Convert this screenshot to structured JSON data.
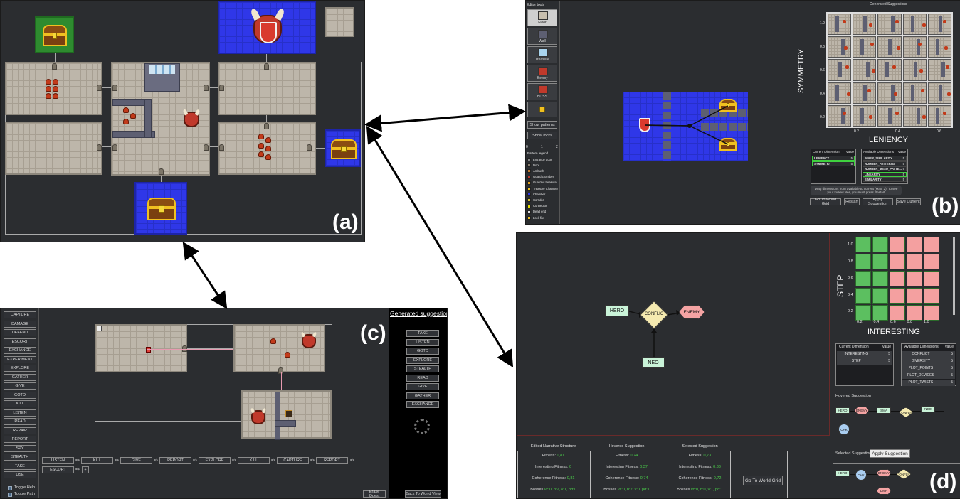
{
  "panels": {
    "a": {
      "tag": "(a)"
    },
    "b": {
      "tag": "(b)",
      "tools_title": "Editor tools",
      "tools": [
        "Floor",
        "Wall",
        "Treasure",
        "Enemy",
        "BOSS"
      ],
      "show_patterns": "Show patterns",
      "show_locks": "Show locks",
      "slider_labels": [
        "0",
        "1",
        "2"
      ],
      "legend_title": "Pattern legend",
      "legend": [
        "Entrance door",
        "Door",
        "Ambush",
        "Guard chamber",
        "Guarded treasure",
        "Treasure Chamber",
        "Chamber",
        "Corridor",
        "Connector",
        "Dead end",
        "Lock file"
      ],
      "generated_title": "Generated Suggestions",
      "y_axis_label": "SYMMETRY",
      "x_axis_label": "LENIENCY",
      "y_ticks": [
        "1.0",
        "0.8",
        "0.6",
        "0.4",
        "0.2"
      ],
      "x_ticks": [
        "0.2",
        "0.4",
        "0.6"
      ],
      "current_dim_header": [
        "Current Dimension",
        "Value"
      ],
      "current_dims": [
        [
          "LENIENCY",
          "5"
        ],
        [
          "SYMMETRY",
          "5"
        ]
      ],
      "available_dim_header": [
        "Available Dimensions",
        "Value"
      ],
      "available_dims": [
        [
          "INNER_SIMILARITY",
          "5"
        ],
        [
          "NUMBER_PATTERNS",
          "5"
        ],
        [
          "NUMBER_MESO_PATTE...",
          "5"
        ],
        [
          "LINEARITY",
          "5"
        ],
        [
          "SIMILARITY",
          "5"
        ]
      ],
      "hint": "Drag dimensions from available to current (Max. 2). To see your locked tiles, you must press Restart",
      "buttons": [
        "Go To World Grid",
        "Restart",
        "Apply Suggestion",
        "Save Current"
      ]
    },
    "c": {
      "tag": "(c)",
      "actions": [
        "CAPTURE",
        "DAMAGE",
        "DEFEND",
        "ESCORT",
        "EXCHANGE",
        "EXPERIMENT",
        "EXPLORE",
        "GATHER",
        "GIVE",
        "GOTO",
        "KILL",
        "LISTEN",
        "READ",
        "REPAIR",
        "REPORT",
        "SPY",
        "STEALTH",
        "TAKE",
        "USE"
      ],
      "toggles": [
        "Toggle Help",
        "Toggle Path"
      ],
      "generated_title": "Generated suggestions",
      "suggestions": [
        "TAKE",
        "LISTEN",
        "GOTO",
        "EXPLORE",
        "STEALTH",
        "READ",
        "GIVE",
        "GATHER",
        "EXCHANGE"
      ],
      "quest_row1": [
        "LISTEN",
        "KILL",
        "GIVE",
        "REPORT",
        "EXPLORE",
        "KILL",
        "CAPTURE",
        "REPORT"
      ],
      "quest_row2": [
        "ESCORT"
      ],
      "plus": "+",
      "arrow_glyph": "=>",
      "erase_quest": "Erase Quest",
      "back_world": "Back To World View"
    },
    "d": {
      "tag": "(d)",
      "nodes": {
        "hero": "HERO",
        "conflict": "CONFLIC",
        "enemy": "ENEMY",
        "neo": "NEO"
      },
      "y_axis_label": "STEP",
      "x_axis_label": "INTERESTING",
      "y_ticks": [
        "1.0",
        "0.8",
        "0.6",
        "0.4",
        "0.2"
      ],
      "x_ticks": [
        "0.2",
        "0.4",
        "0.6",
        "0.8",
        "1.0"
      ],
      "current_dim_header": [
        "Current Dimension",
        "Value"
      ],
      "current_dims": [
        [
          "INTERESTING",
          "5"
        ],
        [
          "STEP",
          "5"
        ]
      ],
      "available_dim_header": [
        "Available Dimensions",
        "Value"
      ],
      "available_dims": [
        [
          "CONFLICT",
          "5"
        ],
        [
          "DIVERSITY",
          "5"
        ],
        [
          "PLOT_POINTS",
          "5"
        ],
        [
          "PLOT_DEVICES",
          "5"
        ],
        [
          "PLOT_TWISTS",
          "5"
        ]
      ],
      "hovered_label": "Hovered Suggestion",
      "selected_label": "Selected Suggestion",
      "apply_button": "Apply Suggestion",
      "hover_nodes": [
        "HERO",
        "ENEMY",
        "SMA",
        "CONFLIC",
        "NEO",
        "CHK"
      ],
      "selected_nodes": [
        "HERO",
        "CHK",
        "ENEMY",
        "CONFLIC",
        "DMP"
      ],
      "columns": [
        {
          "title": "Edited Narrative Structure",
          "fitness": "0,81",
          "interesting": "0",
          "coherence": "0,81",
          "bosses": "vc:0, h:2, v:1, pd:0"
        },
        {
          "title": "Hovered Suggestion",
          "fitness": "0,74",
          "interesting": "0,37",
          "coherence": "0,74",
          "bosses": "vc:0, h:2, v:0, pd:1"
        },
        {
          "title": "Selected Suggestion",
          "fitness": "0,73",
          "interesting": "0,33",
          "coherence": "0,72",
          "bosses": "vc:0, h:0, v:1, pd:1"
        }
      ],
      "row_labels": {
        "fitness": "Fitness:",
        "interesting": "Interesting Fitness:",
        "coherence": "Coherence Fitness:",
        "bosses": "Bosses"
      },
      "world_button": "Go To World Grid"
    }
  },
  "colors": {
    "panel_bg": "#2b2d30",
    "green_cell": "#5cbf60",
    "red_cell": "#f4a0a0",
    "value_green": "#4bd04b",
    "blue_room": "#2f37e8"
  }
}
